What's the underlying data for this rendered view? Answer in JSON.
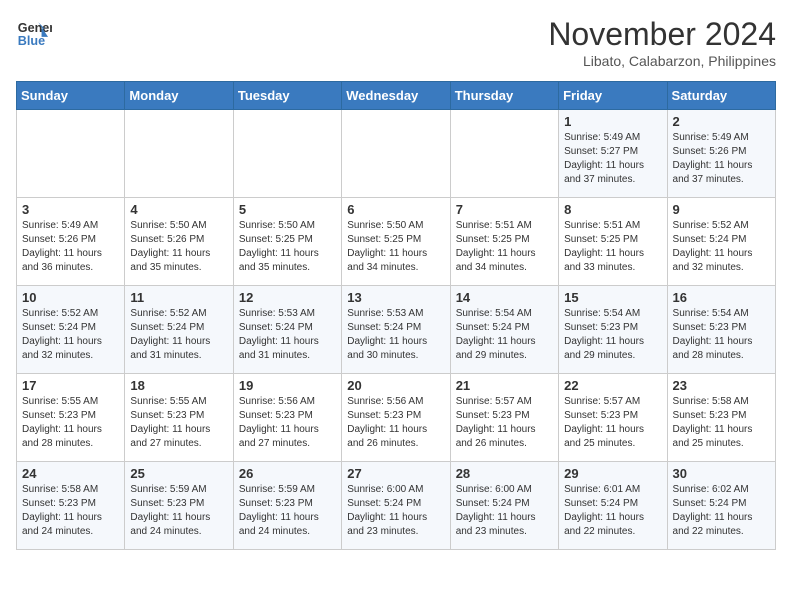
{
  "header": {
    "logo_line1": "General",
    "logo_line2": "Blue",
    "month_title": "November 2024",
    "location": "Libato, Calabarzon, Philippines"
  },
  "weekdays": [
    "Sunday",
    "Monday",
    "Tuesday",
    "Wednesday",
    "Thursday",
    "Friday",
    "Saturday"
  ],
  "weeks": [
    [
      {
        "day": "",
        "info": ""
      },
      {
        "day": "",
        "info": ""
      },
      {
        "day": "",
        "info": ""
      },
      {
        "day": "",
        "info": ""
      },
      {
        "day": "",
        "info": ""
      },
      {
        "day": "1",
        "info": "Sunrise: 5:49 AM\nSunset: 5:27 PM\nDaylight: 11 hours\nand 37 minutes."
      },
      {
        "day": "2",
        "info": "Sunrise: 5:49 AM\nSunset: 5:26 PM\nDaylight: 11 hours\nand 37 minutes."
      }
    ],
    [
      {
        "day": "3",
        "info": "Sunrise: 5:49 AM\nSunset: 5:26 PM\nDaylight: 11 hours\nand 36 minutes."
      },
      {
        "day": "4",
        "info": "Sunrise: 5:50 AM\nSunset: 5:26 PM\nDaylight: 11 hours\nand 35 minutes."
      },
      {
        "day": "5",
        "info": "Sunrise: 5:50 AM\nSunset: 5:25 PM\nDaylight: 11 hours\nand 35 minutes."
      },
      {
        "day": "6",
        "info": "Sunrise: 5:50 AM\nSunset: 5:25 PM\nDaylight: 11 hours\nand 34 minutes."
      },
      {
        "day": "7",
        "info": "Sunrise: 5:51 AM\nSunset: 5:25 PM\nDaylight: 11 hours\nand 34 minutes."
      },
      {
        "day": "8",
        "info": "Sunrise: 5:51 AM\nSunset: 5:25 PM\nDaylight: 11 hours\nand 33 minutes."
      },
      {
        "day": "9",
        "info": "Sunrise: 5:52 AM\nSunset: 5:24 PM\nDaylight: 11 hours\nand 32 minutes."
      }
    ],
    [
      {
        "day": "10",
        "info": "Sunrise: 5:52 AM\nSunset: 5:24 PM\nDaylight: 11 hours\nand 32 minutes."
      },
      {
        "day": "11",
        "info": "Sunrise: 5:52 AM\nSunset: 5:24 PM\nDaylight: 11 hours\nand 31 minutes."
      },
      {
        "day": "12",
        "info": "Sunrise: 5:53 AM\nSunset: 5:24 PM\nDaylight: 11 hours\nand 31 minutes."
      },
      {
        "day": "13",
        "info": "Sunrise: 5:53 AM\nSunset: 5:24 PM\nDaylight: 11 hours\nand 30 minutes."
      },
      {
        "day": "14",
        "info": "Sunrise: 5:54 AM\nSunset: 5:24 PM\nDaylight: 11 hours\nand 29 minutes."
      },
      {
        "day": "15",
        "info": "Sunrise: 5:54 AM\nSunset: 5:23 PM\nDaylight: 11 hours\nand 29 minutes."
      },
      {
        "day": "16",
        "info": "Sunrise: 5:54 AM\nSunset: 5:23 PM\nDaylight: 11 hours\nand 28 minutes."
      }
    ],
    [
      {
        "day": "17",
        "info": "Sunrise: 5:55 AM\nSunset: 5:23 PM\nDaylight: 11 hours\nand 28 minutes."
      },
      {
        "day": "18",
        "info": "Sunrise: 5:55 AM\nSunset: 5:23 PM\nDaylight: 11 hours\nand 27 minutes."
      },
      {
        "day": "19",
        "info": "Sunrise: 5:56 AM\nSunset: 5:23 PM\nDaylight: 11 hours\nand 27 minutes."
      },
      {
        "day": "20",
        "info": "Sunrise: 5:56 AM\nSunset: 5:23 PM\nDaylight: 11 hours\nand 26 minutes."
      },
      {
        "day": "21",
        "info": "Sunrise: 5:57 AM\nSunset: 5:23 PM\nDaylight: 11 hours\nand 26 minutes."
      },
      {
        "day": "22",
        "info": "Sunrise: 5:57 AM\nSunset: 5:23 PM\nDaylight: 11 hours\nand 25 minutes."
      },
      {
        "day": "23",
        "info": "Sunrise: 5:58 AM\nSunset: 5:23 PM\nDaylight: 11 hours\nand 25 minutes."
      }
    ],
    [
      {
        "day": "24",
        "info": "Sunrise: 5:58 AM\nSunset: 5:23 PM\nDaylight: 11 hours\nand 24 minutes."
      },
      {
        "day": "25",
        "info": "Sunrise: 5:59 AM\nSunset: 5:23 PM\nDaylight: 11 hours\nand 24 minutes."
      },
      {
        "day": "26",
        "info": "Sunrise: 5:59 AM\nSunset: 5:23 PM\nDaylight: 11 hours\nand 24 minutes."
      },
      {
        "day": "27",
        "info": "Sunrise: 6:00 AM\nSunset: 5:24 PM\nDaylight: 11 hours\nand 23 minutes."
      },
      {
        "day": "28",
        "info": "Sunrise: 6:00 AM\nSunset: 5:24 PM\nDaylight: 11 hours\nand 23 minutes."
      },
      {
        "day": "29",
        "info": "Sunrise: 6:01 AM\nSunset: 5:24 PM\nDaylight: 11 hours\nand 22 minutes."
      },
      {
        "day": "30",
        "info": "Sunrise: 6:02 AM\nSunset: 5:24 PM\nDaylight: 11 hours\nand 22 minutes."
      }
    ]
  ]
}
